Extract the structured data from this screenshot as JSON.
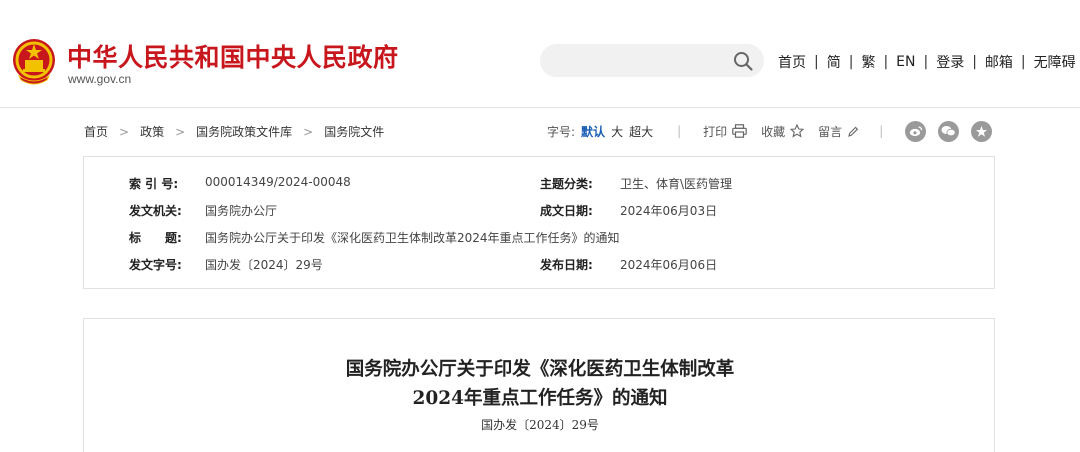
{
  "header": {
    "site_title": "中华人民共和国中央人民政府",
    "site_url": "www.gov.cn",
    "search_placeholder": "",
    "nav": [
      "首页",
      "简",
      "繁",
      "EN",
      "登录",
      "邮箱",
      "无障碍"
    ],
    "nav_separator": "|"
  },
  "breadcrumb": {
    "items": [
      "首页",
      "政策",
      "国务院政策文件库",
      "国务院文件"
    ],
    "separator": ">"
  },
  "toolbar": {
    "font_size_label": "字号:",
    "font_sizes": [
      "默认",
      "大",
      "超大"
    ],
    "active_font_size": "默认",
    "divider": "|",
    "print_label": "打印",
    "favorite_label": "收藏",
    "comment_label": "留言"
  },
  "info": {
    "index_label": "索 引 号:",
    "index_value": "000014349/2024-00048",
    "category_label": "主题分类:",
    "category_value": "卫生、体育\\医药管理",
    "issuer_label": "发文机关:",
    "issuer_value": "国务院办公厅",
    "written_date_label": "成文日期:",
    "written_date_value": "2024年06月03日",
    "title_label": "标　　题:",
    "title_value": "国务院办公厅关于印发《深化医药卫生体制改革2024年重点工作任务》的通知",
    "doc_no_label": "发文字号:",
    "doc_no_value": "国办发〔2024〕29号",
    "publish_date_label": "发布日期:",
    "publish_date_value": "2024年06月06日"
  },
  "article": {
    "title_line1": "国务院办公厅关于印发《深化医药卫生体制改革",
    "title_line2": "2024年重点工作任务》的通知",
    "doc_no": "国办发〔2024〕29号"
  },
  "colors": {
    "brand_red": "#c8161d",
    "active_blue": "#1a5fb4",
    "icon_gray": "#9a9a9a"
  },
  "icons": [
    "national-emblem-icon",
    "search-icon",
    "print-icon",
    "star-icon",
    "pencil-icon",
    "weibo-icon",
    "wechat-icon",
    "party-icon"
  ]
}
